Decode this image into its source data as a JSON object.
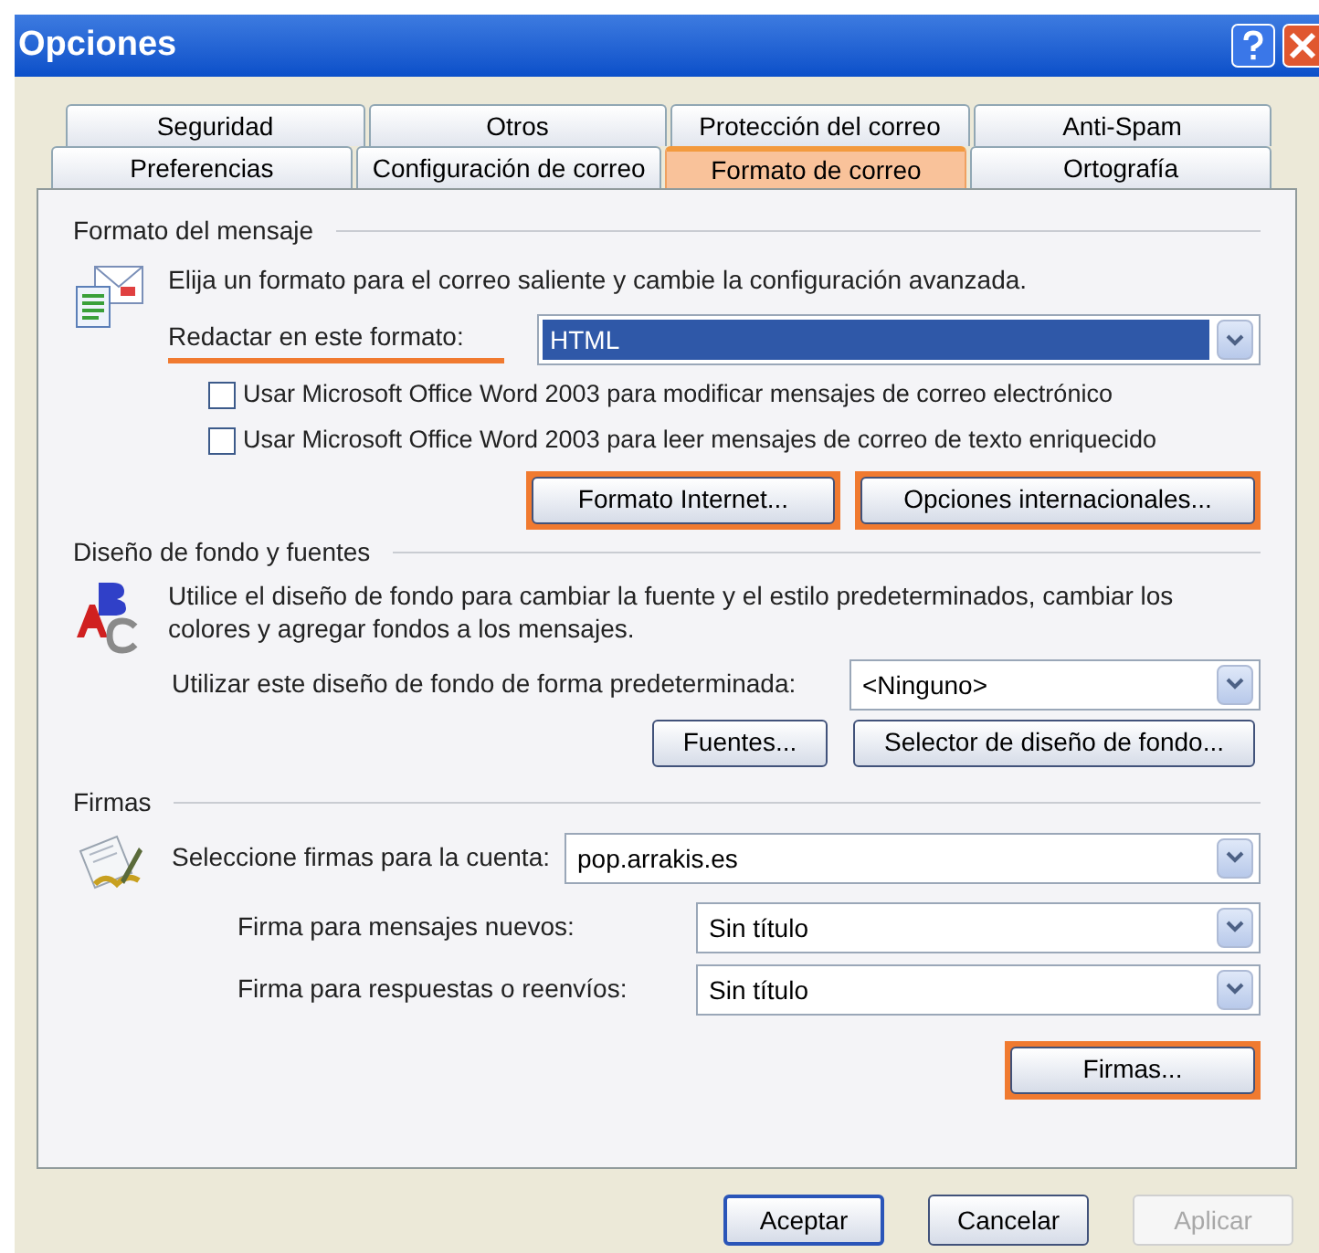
{
  "window": {
    "title": "Opciones"
  },
  "tab_rows": [
    [
      {
        "label": "Seguridad",
        "selected": false
      },
      {
        "label": "Otros",
        "selected": false
      },
      {
        "label": "Protección del correo",
        "selected": false
      },
      {
        "label": "Anti-Spam",
        "selected": false
      }
    ],
    [
      {
        "label": "Preferencias",
        "selected": false
      },
      {
        "label": "Configuración de correo",
        "selected": false
      },
      {
        "label": "Formato de correo",
        "selected": true
      },
      {
        "label": "Ortografía",
        "selected": false
      }
    ]
  ],
  "message_format": {
    "heading": "Formato del mensaje",
    "description": "Elija un formato para el correo saliente y cambie la configuración avanzada.",
    "compose_label": {
      "text": "Redactar en este formato:",
      "highlighted": true
    },
    "compose_select": {
      "value": "HTML",
      "focused": true
    },
    "checkboxes": [
      {
        "label": "Usar Microsoft Office Word 2003 para modificar mensajes de correo electrónico",
        "checked": false
      },
      {
        "label": "Usar Microsoft Office Word 2003 para leer mensajes de correo de texto enriquecido",
        "checked": false
      }
    ],
    "buttons": [
      {
        "label": "Formato Internet...",
        "highlighted": true
      },
      {
        "label": "Opciones internacionales...",
        "highlighted": true
      }
    ]
  },
  "stationery": {
    "heading": "Diseño de fondo y fuentes",
    "description": "Utilice el diseño de fondo para cambiar la fuente y el estilo predeterminados, cambiar los colores y agregar fondos a los mensajes.",
    "default_label": "Utilizar este diseño de fondo de forma predeterminada:",
    "default_select": {
      "value": "<Ninguno>"
    },
    "buttons": [
      {
        "label": "Fuentes...",
        "highlighted": false
      },
      {
        "label": "Selector de diseño de fondo...",
        "highlighted": false
      }
    ]
  },
  "signatures": {
    "heading": "Firmas",
    "account_label": "Seleccione firmas para la cuenta:",
    "account_select": {
      "value": "pop.arrakis.es"
    },
    "rows": [
      {
        "label": "Firma para mensajes nuevos:",
        "value": "Sin título"
      },
      {
        "label": "Firma para respuestas o reenvíos:",
        "value": "Sin título"
      }
    ],
    "buttons": [
      {
        "label": "Firmas...",
        "highlighted": true
      }
    ]
  },
  "footer_buttons": [
    {
      "label": "Aceptar",
      "disabled": false,
      "default": true
    },
    {
      "label": "Cancelar",
      "disabled": false,
      "default": false
    },
    {
      "label": "Aplicar",
      "disabled": true,
      "default": false
    }
  ]
}
